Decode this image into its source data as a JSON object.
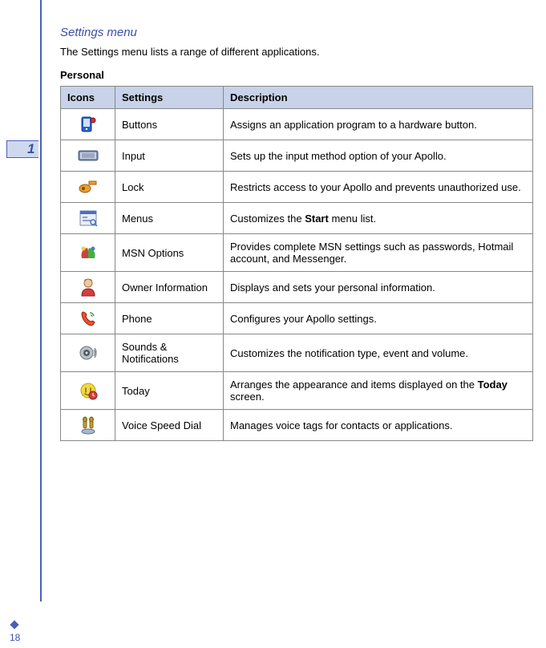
{
  "tab_number": "1",
  "heading": "Settings menu",
  "intro": "The Settings menu lists a range of different applications.",
  "section_label": "Personal",
  "headers": {
    "icons": "Icons",
    "settings": "Settings",
    "description": "Description"
  },
  "rows": [
    {
      "icon": "buttons-icon",
      "setting": "Buttons",
      "description": "Assigns an application program to a hardware button."
    },
    {
      "icon": "input-icon",
      "setting": "Input",
      "description": "Sets up the input method option of your Apollo."
    },
    {
      "icon": "lock-icon",
      "setting": "Lock",
      "description": "Restricts access to your Apollo and prevents unauthorized use."
    },
    {
      "icon": "menus-icon",
      "setting": "Menus",
      "description_html": "Customizes the <b>Start</b> menu list."
    },
    {
      "icon": "msn-icon",
      "setting": "MSN Options",
      "description": "Provides complete MSN settings such as passwords, Hotmail account, and Messenger."
    },
    {
      "icon": "owner-icon",
      "setting": "Owner Information",
      "description": "Displays and sets your personal information."
    },
    {
      "icon": "phone-icon",
      "setting": "Phone",
      "description": "Configures your Apollo settings."
    },
    {
      "icon": "sounds-icon",
      "setting": "Sounds & Notifications",
      "description": "Customizes the notification type, event and volume."
    },
    {
      "icon": "today-icon",
      "setting": "Today",
      "description_html": "Arranges the appearance and items displayed on the <b>Today</b> screen."
    },
    {
      "icon": "voice-icon",
      "setting": "Voice Speed Dial",
      "description": "Manages voice tags for contacts or applications."
    }
  ],
  "page_number": "18"
}
